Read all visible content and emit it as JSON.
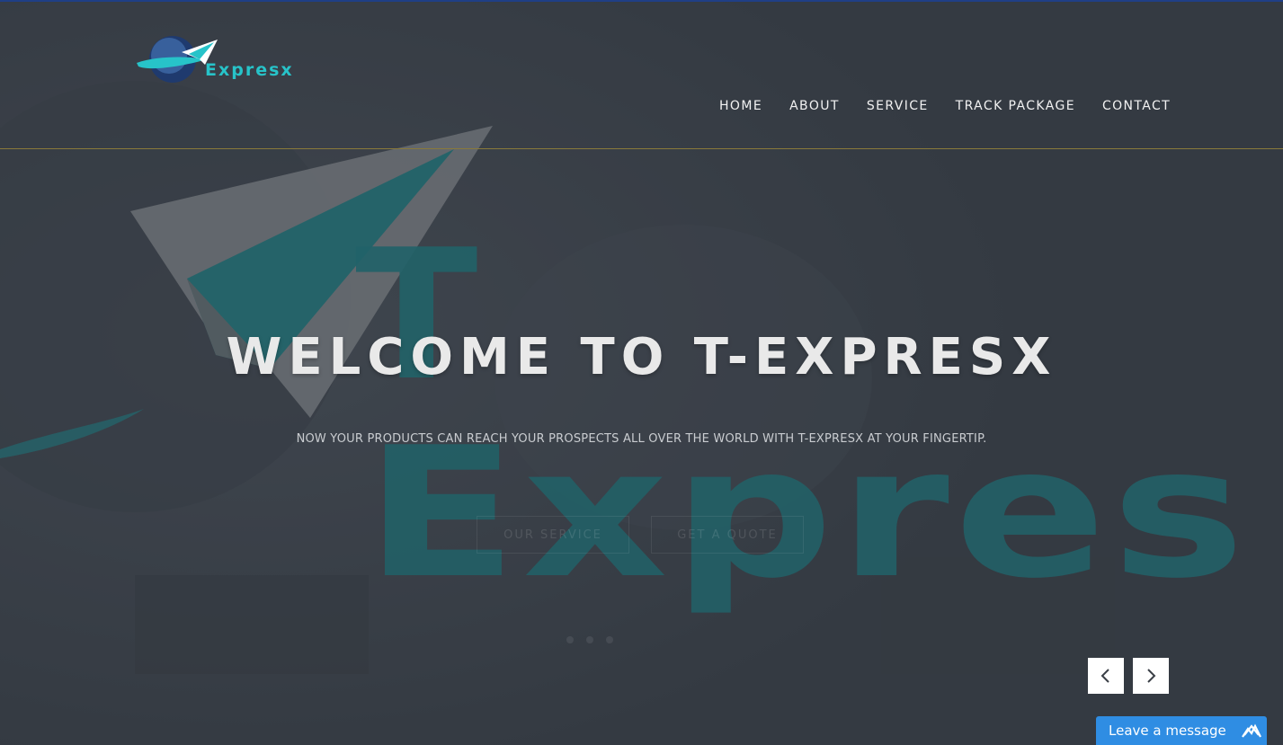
{
  "colors": {
    "accent": "#27c3c9",
    "teal_dark": "#1f8c91",
    "chat_bg": "#2f8de3",
    "top_strip": "#1f3f86"
  },
  "header": {
    "logo_text": "Expresx",
    "nav": [
      {
        "label": "HOME"
      },
      {
        "label": "ABOUT"
      },
      {
        "label": "SERVICE"
      },
      {
        "label": "TRACK PACKAGE"
      },
      {
        "label": "CONTACT"
      }
    ]
  },
  "hero": {
    "background_word": "Expres",
    "background_letter": "T",
    "title": "WELCOME TO T-EXPRESX",
    "subtitle": "NOW YOUR PRODUCTS CAN REACH YOUR PROSPECTS ALL OVER THE WORLD WITH T-EXPRESX AT YOUR FINGERTIP.",
    "buttons": [
      {
        "label": "OUR SERVICE"
      },
      {
        "label": "GET A QUOTE"
      }
    ]
  },
  "slider": {
    "prev_icon": "chevron-left-icon",
    "next_icon": "chevron-right-icon"
  },
  "chat": {
    "label": "Leave a message",
    "icon": "maximize-icon"
  }
}
